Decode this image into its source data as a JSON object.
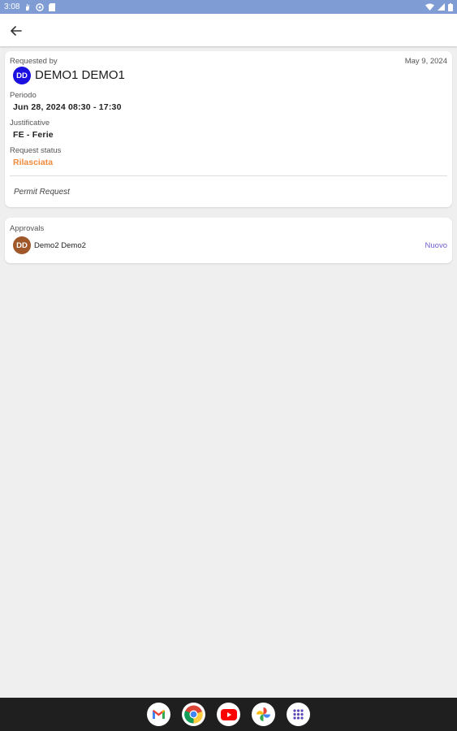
{
  "status_bar": {
    "time": "3:08"
  },
  "request": {
    "requested_by_label": "Requested by",
    "date": "May 9, 2024",
    "requester_initials": "DD",
    "requester_name": "DEMO1 DEMO1",
    "period_label": "Periodo",
    "period_value": "Jun 28, 2024 08:30 - 17:30",
    "justification_label": "Justificative",
    "justification_value": "FE - Ferie",
    "status_label": "Request status",
    "status_value": "Rilasciata",
    "request_type": "Permit Request"
  },
  "approvals": {
    "label": "Approvals",
    "items": [
      {
        "initials": "DD",
        "name": "Demo2 Demo2",
        "status": "Nuovo"
      }
    ]
  },
  "dock": {
    "apps": [
      "gmail-icon",
      "chrome-icon",
      "youtube-icon",
      "photos-icon",
      "app-drawer-icon"
    ]
  },
  "colors": {
    "status_bar": "#7f9dd4",
    "avatar_requester": "#1a10e0",
    "avatar_approver": "#a0582a",
    "status_released": "#f08a3c",
    "approval_status": "#6e5dd0"
  }
}
